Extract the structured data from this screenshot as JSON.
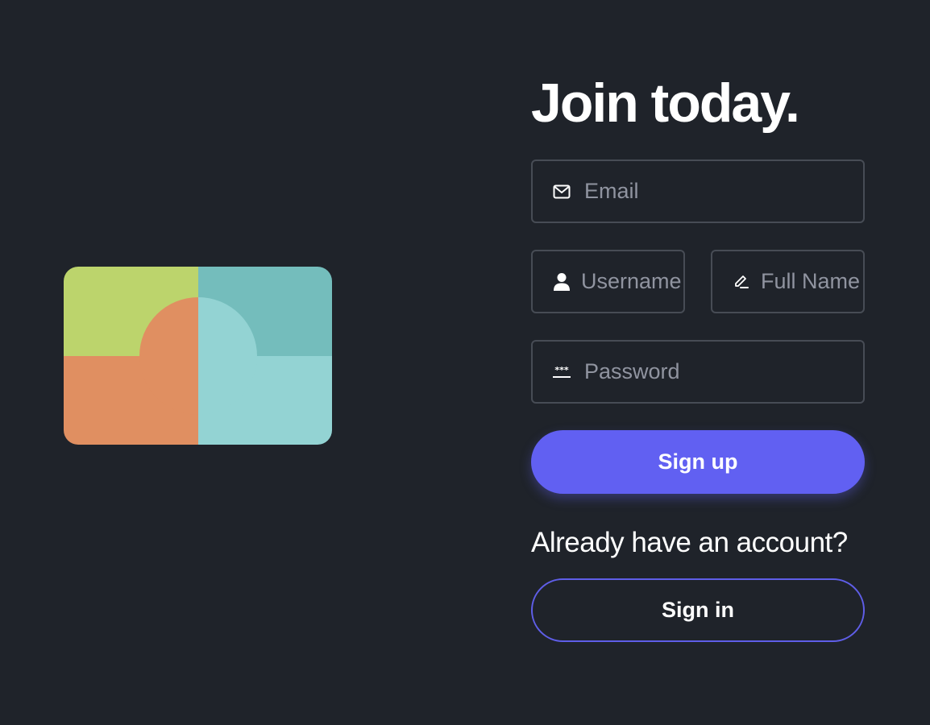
{
  "logo": {
    "colors": {
      "top_left": "#bcd46c",
      "top_right": "#74bdbc",
      "bottom_left": "#e08f61",
      "bottom_right": "#93d3d3",
      "circle_left": "#e08f61",
      "circle_right": "#93d3d3"
    }
  },
  "heading": "Join today.",
  "form": {
    "email": {
      "placeholder": "Email",
      "icon": "envelope-icon"
    },
    "username": {
      "placeholder": "Username",
      "icon": "user-icon"
    },
    "fullname": {
      "placeholder": "Full Name",
      "icon": "pen-icon"
    },
    "password": {
      "placeholder": "Password",
      "icon": "password-icon"
    },
    "signup_label": "Sign up"
  },
  "signin_prompt": "Already have an account?",
  "signin_label": "Sign in",
  "colors": {
    "background": "#1f232a",
    "accent": "#6160f2",
    "field_border": "#474c55",
    "placeholder": "#9094a0"
  }
}
